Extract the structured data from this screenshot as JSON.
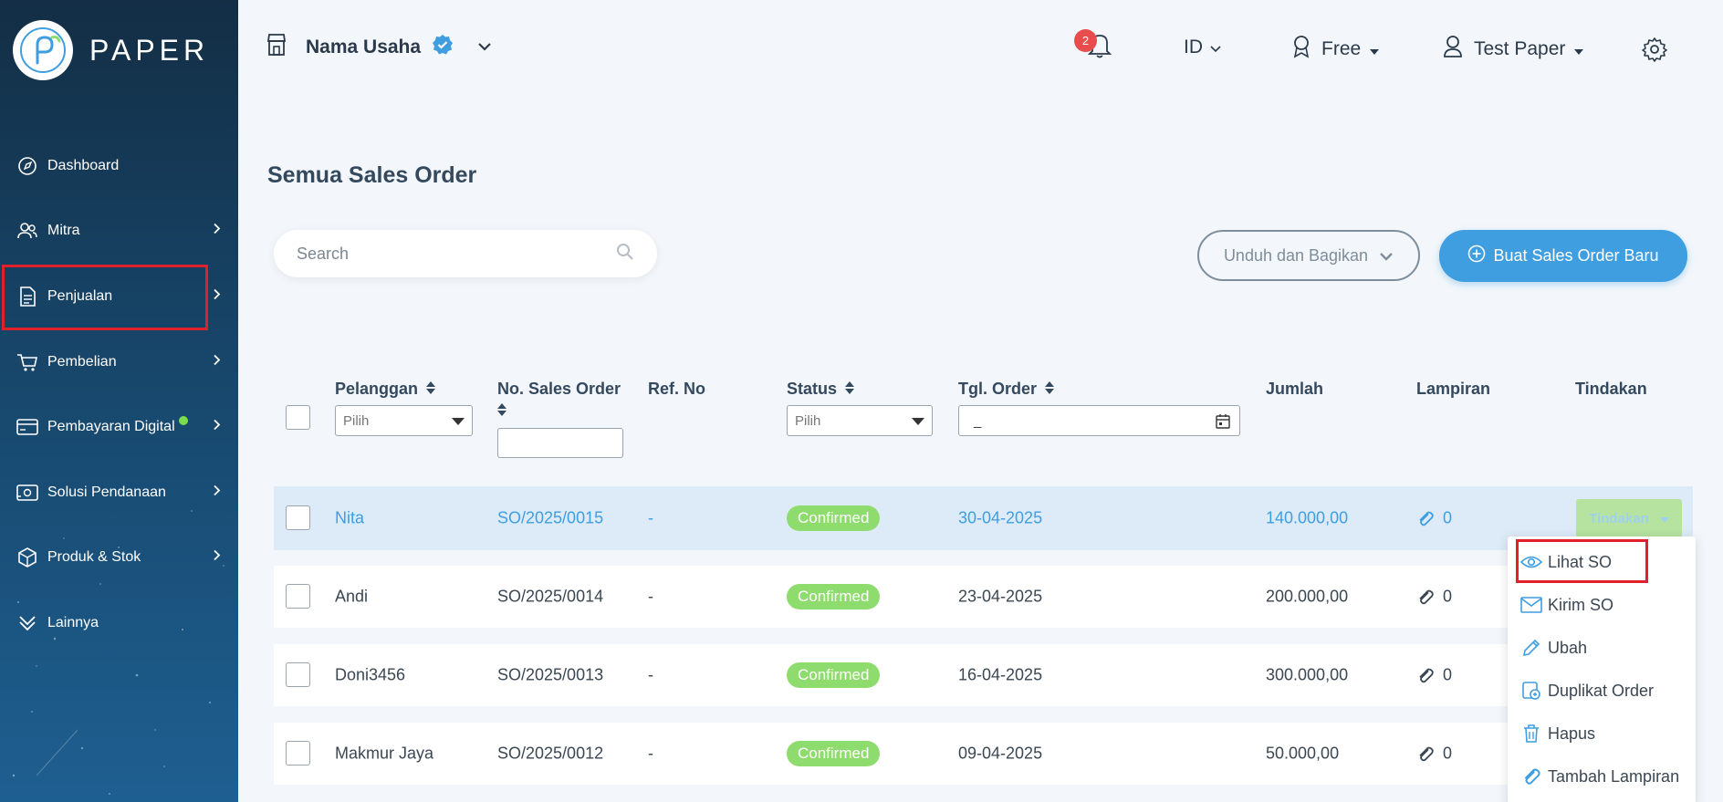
{
  "brand": {
    "name": "PAPER"
  },
  "sidebar": {
    "items": [
      {
        "label": "Dashboard",
        "icon": "compass-icon",
        "has_chevron": false
      },
      {
        "label": "Mitra",
        "icon": "users-icon",
        "has_chevron": true
      },
      {
        "label": "Penjualan",
        "icon": "document-icon",
        "has_chevron": true
      },
      {
        "label": "Pembelian",
        "icon": "cart-icon",
        "has_chevron": true
      },
      {
        "label": "Pembayaran Digital",
        "icon": "card-icon",
        "has_chevron": true,
        "dot": true
      },
      {
        "label": "Solusi Pendanaan",
        "icon": "money-icon",
        "has_chevron": true
      },
      {
        "label": "Produk & Stok",
        "icon": "box-icon",
        "has_chevron": true
      },
      {
        "label": "Lainnya",
        "icon": "chevrons-down-icon",
        "has_chevron": false
      }
    ]
  },
  "header": {
    "business_name": "Nama Usaha",
    "notifications_count": "2",
    "language": "ID",
    "plan": "Free",
    "user": "Test Paper"
  },
  "page": {
    "title": "Semua Sales Order",
    "search_placeholder": "Search",
    "download_share_label": "Unduh dan Bagikan",
    "create_label": "Buat Sales Order Baru"
  },
  "table": {
    "headers": {
      "pelanggan": "Pelanggan",
      "no_so": "No. Sales Order",
      "ref": "Ref. No",
      "status": "Status",
      "tgl": "Tgl. Order",
      "jumlah": "Jumlah",
      "lampiran": "Lampiran",
      "tindakan": "Tindakan"
    },
    "filters": {
      "pelanggan_placeholder": "Pilih",
      "status_placeholder": "Pilih",
      "date_value": "_"
    },
    "rows": [
      {
        "customer": "Nita",
        "so": "SO/2025/0015",
        "ref": "-",
        "status": "Confirmed",
        "date": "30-04-2025",
        "amount": "140.000,00",
        "attachments": "0"
      },
      {
        "customer": "Andi",
        "so": "SO/2025/0014",
        "ref": "-",
        "status": "Confirmed",
        "date": "23-04-2025",
        "amount": "200.000,00",
        "attachments": "0"
      },
      {
        "customer": "Doni3456",
        "so": "SO/2025/0013",
        "ref": "-",
        "status": "Confirmed",
        "date": "16-04-2025",
        "amount": "300.000,00",
        "attachments": "0"
      },
      {
        "customer": "Makmur Jaya",
        "so": "SO/2025/0012",
        "ref": "-",
        "status": "Confirmed",
        "date": "09-04-2025",
        "amount": "50.000,00",
        "attachments": "0"
      }
    ],
    "action_button": "Tindakan"
  },
  "action_menu": {
    "items": [
      {
        "label": "Lihat SO",
        "icon": "eye-icon"
      },
      {
        "label": "Kirim SO",
        "icon": "mail-icon"
      },
      {
        "label": "Ubah",
        "icon": "pencil-icon"
      },
      {
        "label": "Duplikat Order",
        "icon": "duplicate-icon"
      },
      {
        "label": "Hapus",
        "icon": "trash-icon"
      },
      {
        "label": "Tambah Lampiran",
        "icon": "paperclip-icon"
      }
    ]
  },
  "colors": {
    "accent": "#3f9ee0",
    "status_green": "#8fdc6e",
    "highlight_red": "#e0202a",
    "sidebar_dark": "#132e45"
  }
}
